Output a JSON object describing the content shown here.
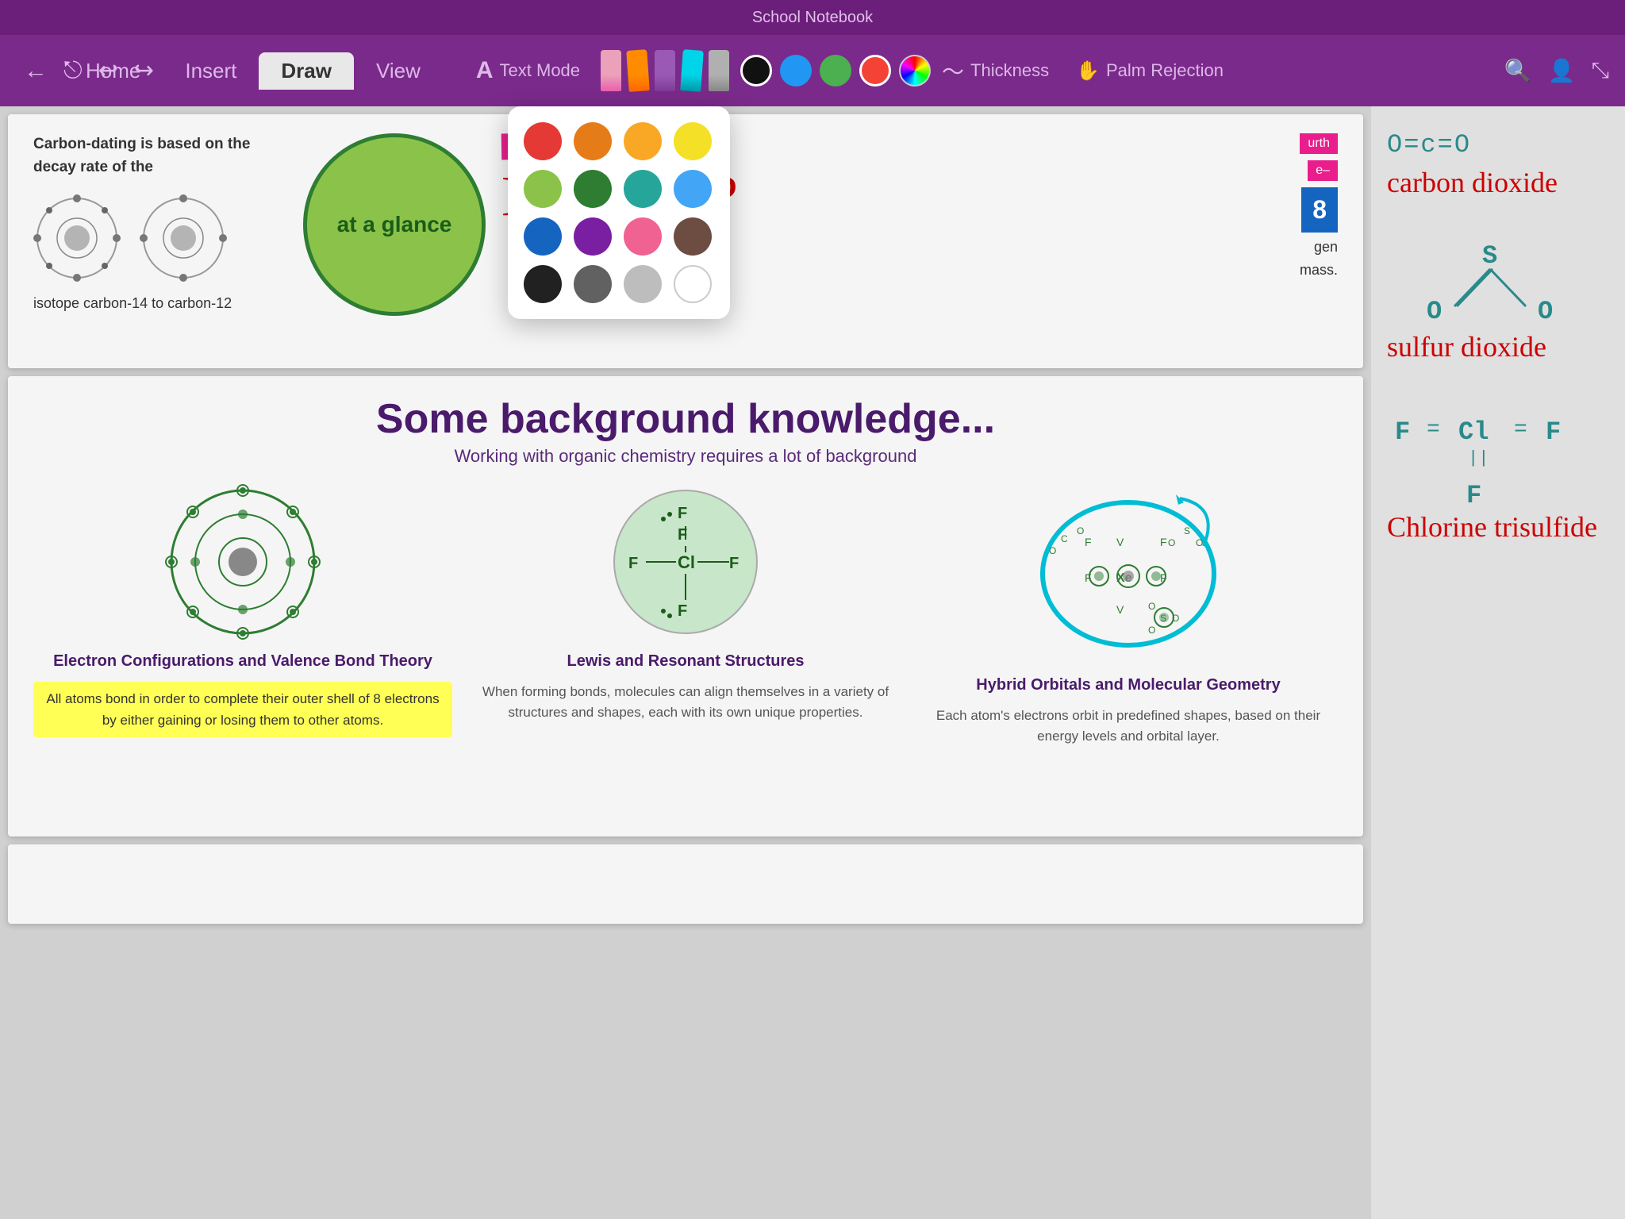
{
  "titleBar": {
    "title": "School Notebook"
  },
  "toolbar": {
    "tabs": [
      {
        "label": "Home",
        "active": false
      },
      {
        "label": "Insert",
        "active": false
      },
      {
        "label": "Draw",
        "active": true
      },
      {
        "label": "View",
        "active": false
      }
    ],
    "textModeLabel": "Text Mode",
    "thicknessLabel": "Thickness",
    "palmRejectionLabel": "Palm Rejection",
    "colors": {
      "swatches": [
        {
          "color": "#000000",
          "selected": true
        },
        {
          "color": "#2196F3",
          "selected": false
        },
        {
          "color": "#4CAF50",
          "selected": false
        },
        {
          "color": "#F44336",
          "selected": false
        }
      ]
    }
  },
  "colorPicker": {
    "colors": [
      "#e53935",
      "#e67c17",
      "#f9a825",
      "#f4e026",
      "#8bc34a",
      "#2e7d32",
      "#26a69a",
      "#42a5f5",
      "#1565c0",
      "#7b1fa2",
      "#f06292",
      "#6d4c41",
      "#212121",
      "#616161",
      "#bdbdbd",
      "#ffffff"
    ]
  },
  "page1": {
    "carbonText": "Carbon-dating is based on the decay rate of the",
    "isotopeLabel": "isotope carbon-14 to carbon-12",
    "atAGlanceLabel": "at a glance",
    "halfLifeText": "Half Life?"
  },
  "page2": {
    "heading": "Some background knowledge...",
    "subheading": "Working with organic chemistry requires a lot of background",
    "cards": [
      {
        "title": "Electron Configurations and Valence Bond Theory",
        "desc": "",
        "highlight": "All atoms bond in order to complete their outer shell of 8 electrons by either gaining or losing them to other atoms."
      },
      {
        "title": "Lewis and Resonant Structures",
        "desc": "When forming bonds, molecules can align themselves in a variety of structures and shapes, each with its own unique properties.",
        "highlight": ""
      },
      {
        "title": "Hybrid Orbitals and Molecular Geometry",
        "desc": "Each atom's electrons orbit in predefined shapes, based on their energy levels and orbital layer.",
        "highlight": ""
      }
    ]
  },
  "rightSidebar": {
    "molecules": [
      {
        "formula": "O=c=O",
        "name": "carbon dioxide"
      },
      {
        "formula": "S||O·O",
        "name": "sulfur dioxide"
      },
      {
        "formula": "F=Cl=F",
        "name": "Chlorine trisulfide"
      }
    ]
  },
  "icons": {
    "back": "←",
    "share": "⎋",
    "undo": "↩",
    "redo": "↪",
    "search": "🔍",
    "addUser": "👤+",
    "collapse": "⤡"
  }
}
